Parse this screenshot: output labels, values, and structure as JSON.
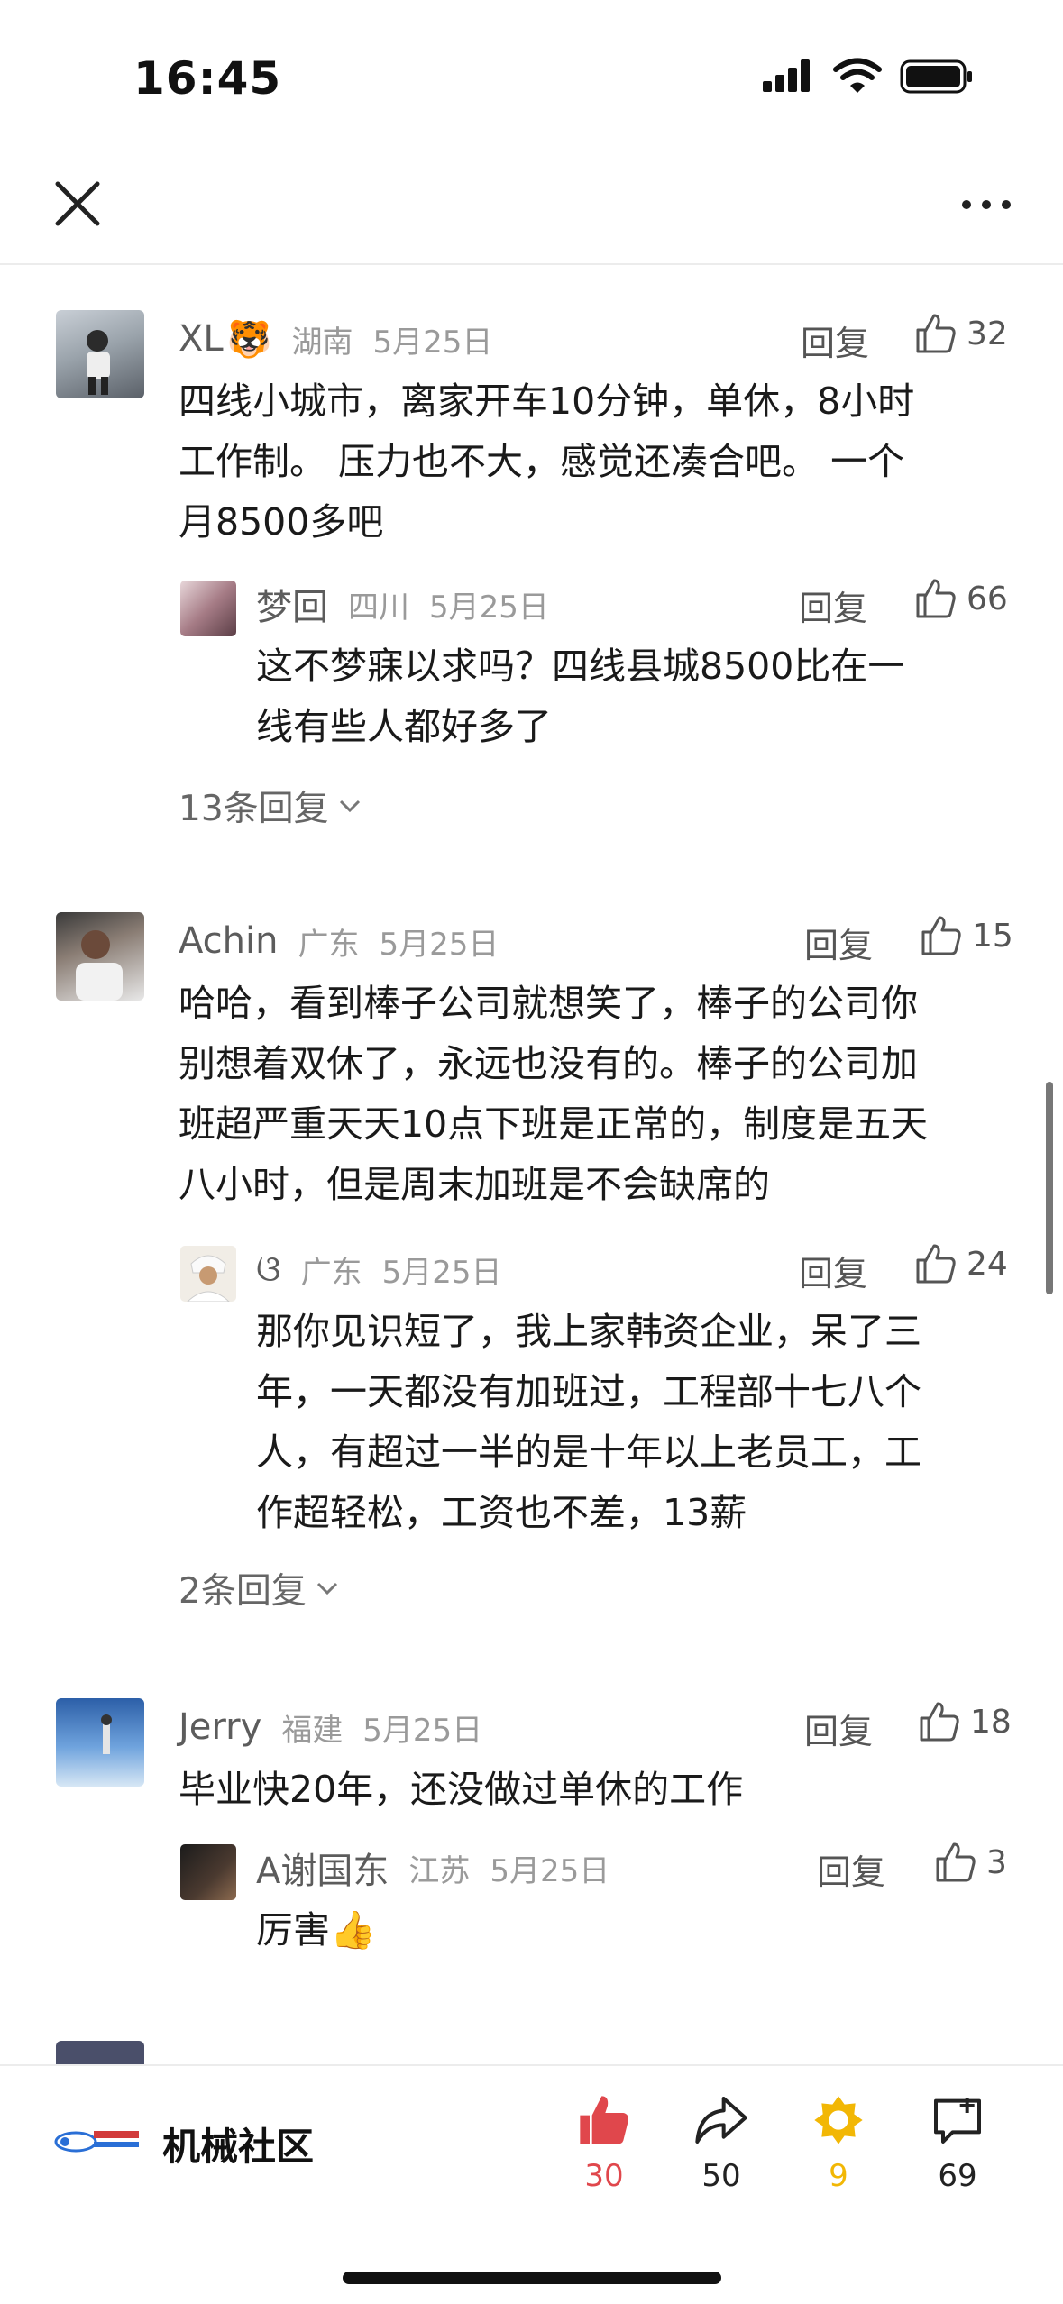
{
  "status_bar": {
    "time": "16:45"
  },
  "comments": [
    {
      "user": "XL",
      "emoji": "🐯",
      "location": "湖南",
      "date": "5月25日",
      "reply_label": "回复",
      "likes": "32",
      "lines": [
        "四线小城市，离家开车10分钟，单休，8小时",
        "工作制。 压力也不大，感觉还凑合吧。 一个",
        "月8500多吧"
      ],
      "sub_reply": {
        "user": "梦回",
        "location": "四川",
        "date": "5月25日",
        "reply_label": "回复",
        "likes": "66",
        "lines": [
          "这不梦寐以求吗？四线县城8500比在一",
          "线有些人都好多了"
        ]
      },
      "more_replies": "13条回复"
    },
    {
      "user": "Achin",
      "location": "广东",
      "date": "5月25日",
      "reply_label": "回复",
      "likes": "15",
      "lines": [
        "哈哈，看到棒子公司就想笑了，棒子的公司你",
        "别想着双休了，永远也没有的。棒子的公司加",
        "班超严重天天10点下班是正常的，制度是五天",
        "八小时，但是周末加班是不会缺席的"
      ],
      "sub_reply": {
        "user": "ଓ",
        "location": "广东",
        "date": "5月25日",
        "reply_label": "回复",
        "likes": "24",
        "lines": [
          "那你见识短了，我上家韩资企业，呆了三",
          "年，一天都没有加班过，工程部十七八个",
          "人，有超过一半的是十年以上老员工，工",
          "作超轻松，工资也不差，13薪"
        ]
      },
      "more_replies": "2条回复"
    },
    {
      "user": "Jerry",
      "location": "福建",
      "date": "5月25日",
      "reply_label": "回复",
      "likes": "18",
      "lines": [
        "毕业快20年，还没做过单休的工作"
      ],
      "sub_reply": {
        "user": "A谢国东",
        "location": "江苏",
        "date": "5月25日",
        "reply_label": "回复",
        "likes": "3",
        "lines": [
          "厉害👍"
        ]
      }
    }
  ],
  "bottom_bar": {
    "brand": "机械社区",
    "like_count": "30",
    "share_count": "50",
    "favorite_count": "9",
    "comment_count": "69"
  },
  "colors": {
    "accent_red": "#e0474c",
    "favorite_gold": "#f2b705",
    "text": "#1a1a1a",
    "meta": "#9a9a9a"
  }
}
